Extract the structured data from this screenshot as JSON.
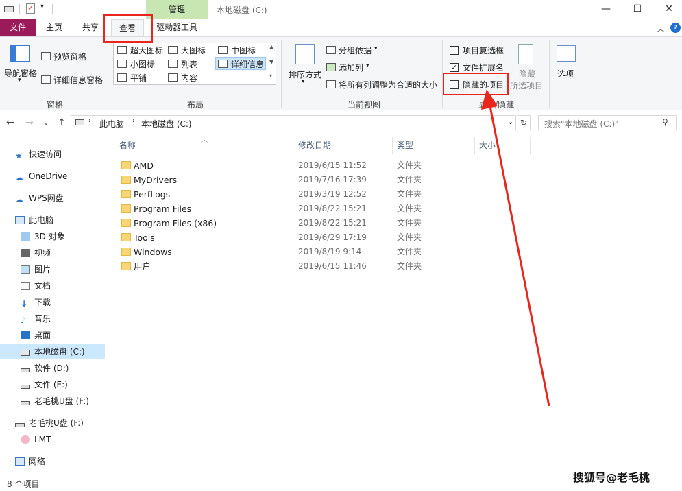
{
  "title_bar": {
    "manage_tab": "管理",
    "window_title": "本地磁盘 (C:)",
    "minimize": "—",
    "maximize": "☐",
    "close": "✕"
  },
  "tabs": {
    "file": "文件",
    "home": "主页",
    "share": "共享",
    "view": "查看",
    "drive_tools": "驱动器工具"
  },
  "ribbon": {
    "nav_pane": "导航窗格",
    "preview_pane": "预览窗格",
    "details_pane": "详细信息窗格",
    "panes_group": "窗格",
    "layout": {
      "extra_large": "超大图标",
      "large": "大图标",
      "medium": "中图标",
      "small": "小图标",
      "list": "列表",
      "details": "详细信息",
      "tiles": "平铺",
      "content": "内容",
      "group": "布局"
    },
    "sort_by": "排序方式",
    "group_by": "分组依据",
    "add_columns": "添加列",
    "size_all_columns": "将所有列调整为合适的大小",
    "current_view_group": "当前视图",
    "item_checkboxes": "项目复选框",
    "file_extensions": "文件扩展名",
    "hidden_items": "隐藏的项目",
    "hide": "隐藏",
    "selected_items": "所选项目",
    "show_hide_group": "显示/隐藏",
    "options": "选项",
    "checkboxes_checked": {
      "item_checkboxes": false,
      "file_extensions": true,
      "hidden_items": false
    }
  },
  "address": {
    "this_pc": "此电脑",
    "drive": "本地磁盘 (C:)",
    "search_placeholder": "搜索\"本地磁盘 (C:)\""
  },
  "sidebar": {
    "quick_access": "快速访问",
    "onedrive": "OneDrive",
    "wps": "WPS网盘",
    "this_pc": "此电脑",
    "objects_3d": "3D 对象",
    "videos": "视频",
    "pictures": "图片",
    "documents": "文档",
    "downloads": "下载",
    "music": "音乐",
    "desktop": "桌面",
    "local_c": "本地磁盘 (C:)",
    "soft_d": "软件 (D:)",
    "file_e": "文件 (E:)",
    "usb_f": "老毛桃U盘 (F:)",
    "usb_f2": "老毛桃U盘 (F:)",
    "lmt": "LMT",
    "network": "网络"
  },
  "columns": {
    "name": "名称",
    "modified": "修改日期",
    "type": "类型",
    "size": "大小"
  },
  "files": [
    {
      "name": "AMD",
      "date": "2019/6/15 11:52",
      "type": "文件夹"
    },
    {
      "name": "MyDrivers",
      "date": "2019/7/16 17:39",
      "type": "文件夹"
    },
    {
      "name": "PerfLogs",
      "date": "2019/3/19 12:52",
      "type": "文件夹"
    },
    {
      "name": "Program Files",
      "date": "2019/8/22 15:21",
      "type": "文件夹"
    },
    {
      "name": "Program Files (x86)",
      "date": "2019/8/22 15:21",
      "type": "文件夹"
    },
    {
      "name": "Tools",
      "date": "2019/6/29 17:19",
      "type": "文件夹"
    },
    {
      "name": "Windows",
      "date": "2019/8/19 9:14",
      "type": "文件夹"
    },
    {
      "name": "用户",
      "date": "2019/6/15 11:46",
      "type": "文件夹"
    }
  ],
  "status": "8 个项目",
  "watermark": "搜狐号@老毛桃",
  "colors": {
    "accent": "#9b1b5a",
    "annotation": "#e8261d",
    "manage_tab": "#c7e6b1"
  }
}
